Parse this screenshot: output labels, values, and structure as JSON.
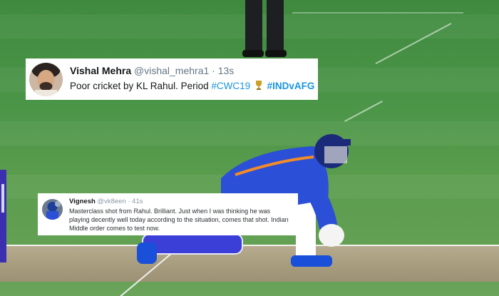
{
  "tweets": [
    {
      "name": "Vishal Mehra",
      "handle": "@vishal_mehra1",
      "separator": "·",
      "time": "13s",
      "text": "Poor cricket by KL Rahul. Period",
      "hashtag1": "#CWC19",
      "trophy_icon": "trophy-icon",
      "hashtag2": "#INDvAFG"
    },
    {
      "name": "Vignesh",
      "handle": "@vk8een",
      "separator": "·",
      "time": "41s",
      "text": "Masterclass shot from Rahul. Brilliant. Just when I was thinking he was playing decently well today according to the situation, comes that shot. Indian Middle order comes to test now."
    }
  ],
  "colors": {
    "grass": "#4b9548",
    "pitch": "#a99e80",
    "kit_blue": "#2b4fd6",
    "hashtag": "#1b95e0"
  }
}
